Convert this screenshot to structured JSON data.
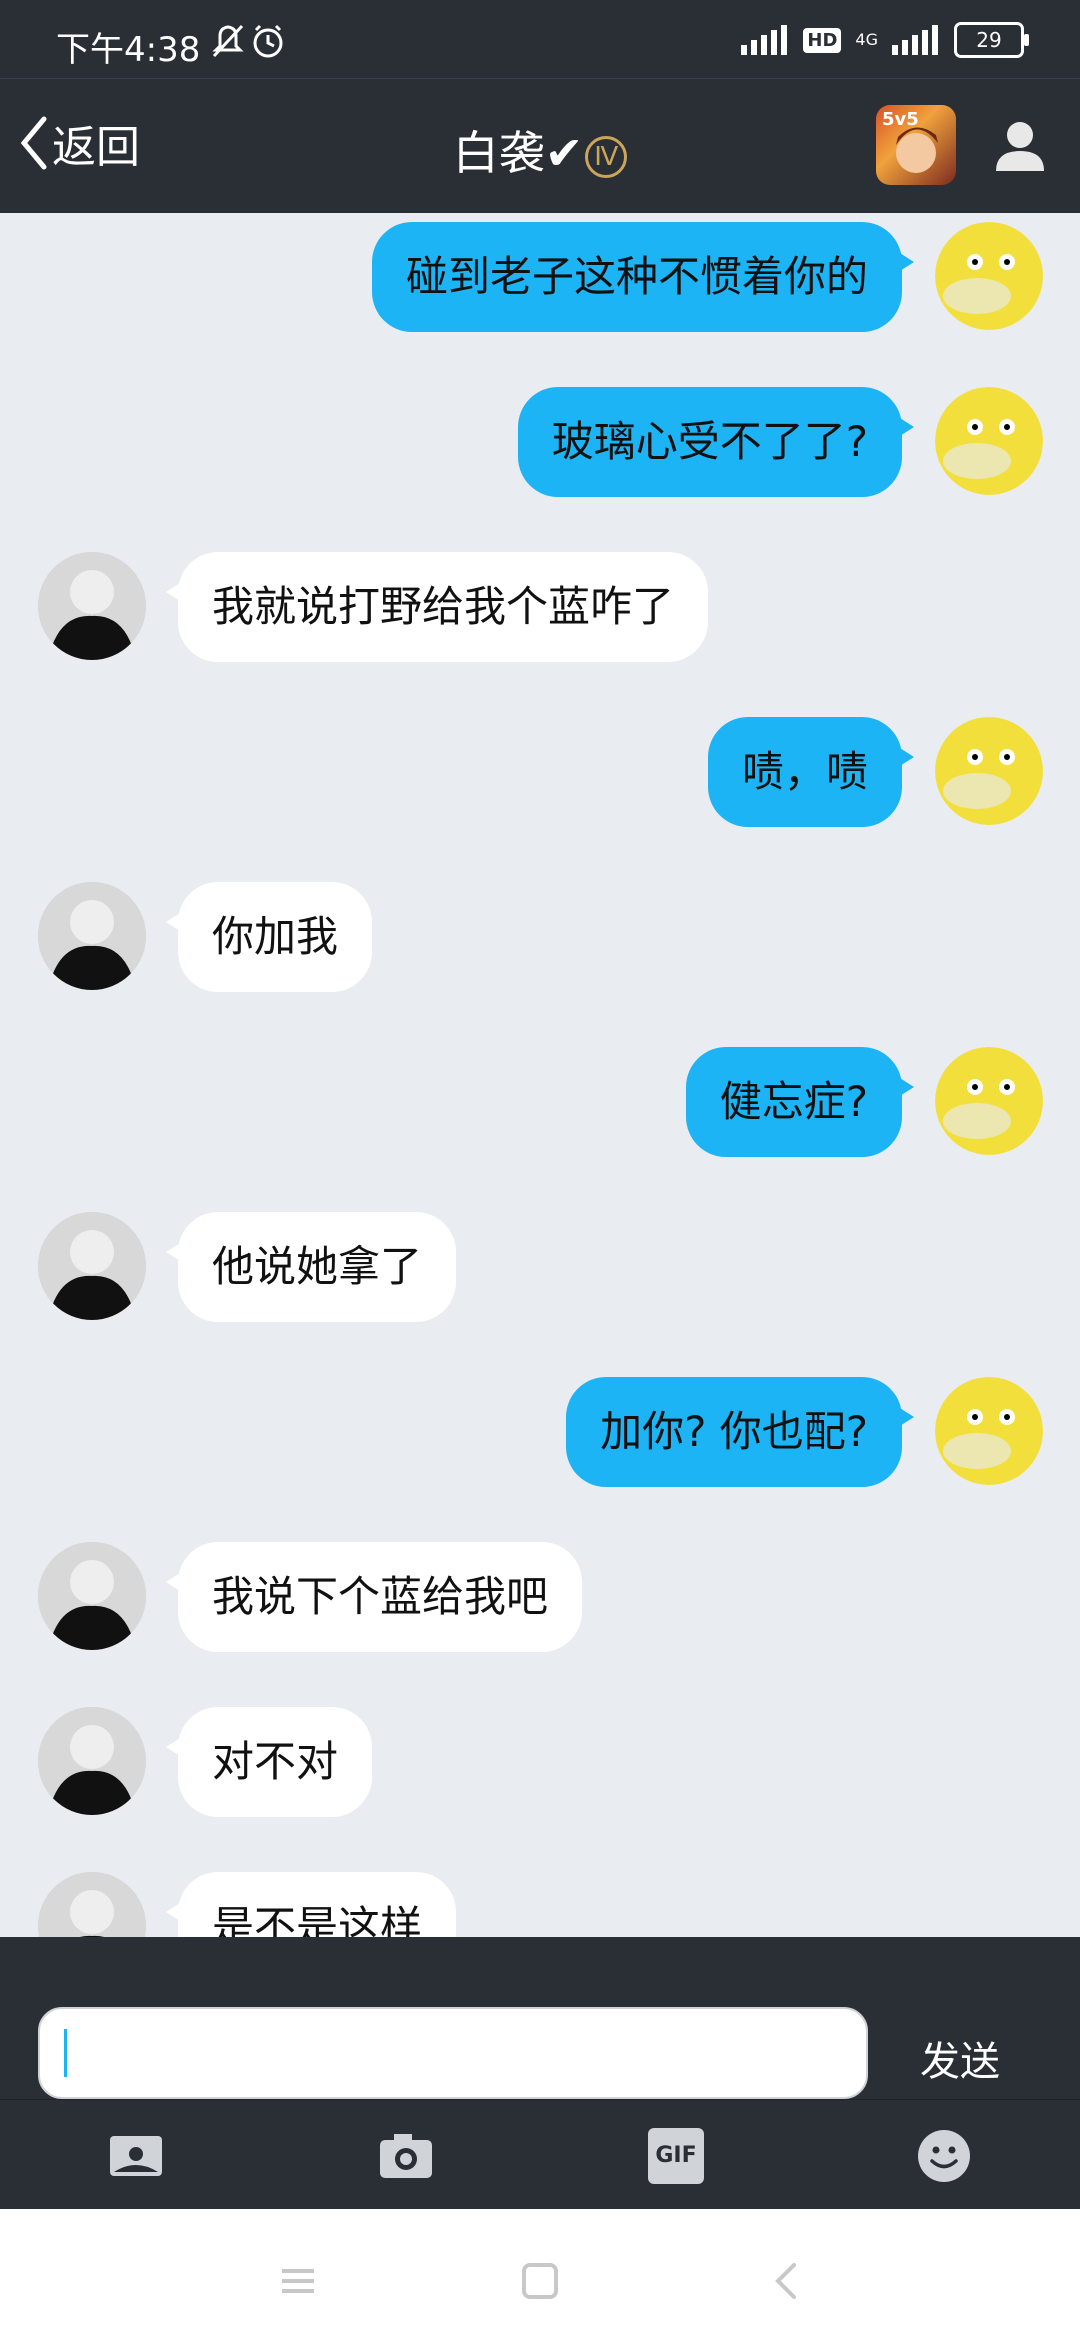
{
  "status": {
    "time": "下午4:38",
    "hd": "HD",
    "network": "4G",
    "battery": "29"
  },
  "header": {
    "back_label": "返回",
    "title": "白袭✔",
    "badge": "Ⅳ",
    "game_icon_text": "5v5"
  },
  "messages": [
    {
      "side": "out",
      "text": "碰到老子这种不惯着你的"
    },
    {
      "side": "out",
      "text": "玻璃心受不了了?"
    },
    {
      "side": "in",
      "text": "我就说打野给我个蓝咋了"
    },
    {
      "side": "out",
      "text": "啧，啧"
    },
    {
      "side": "in",
      "text": "你加我"
    },
    {
      "side": "out",
      "text": "健忘症?"
    },
    {
      "side": "in",
      "text": "他说她拿了"
    },
    {
      "side": "out",
      "text": "加你? 你也配?"
    },
    {
      "side": "in",
      "text": "我说下个蓝给我吧"
    },
    {
      "side": "in",
      "text": "对不对"
    },
    {
      "side": "in",
      "text": "是不是这样"
    }
  ],
  "input": {
    "value": "",
    "send_label": "发送"
  },
  "toolbar": {
    "gif_label": "GIF",
    "items": [
      "image-icon",
      "camera-icon",
      "gif-icon",
      "emoji-icon"
    ]
  },
  "colors": {
    "outgoing_bubble": "#1cb4f4",
    "incoming_bubble": "#ffffff",
    "bar_background": "#2a2e35"
  }
}
